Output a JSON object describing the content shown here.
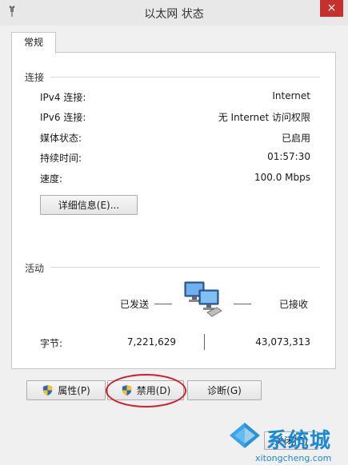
{
  "window": {
    "title": "以太网 状态",
    "close_symbol": "×",
    "system_icon": "network-plug-icon"
  },
  "tabs": [
    {
      "label": "常规"
    }
  ],
  "connection": {
    "section_title": "连接",
    "rows": [
      {
        "label": "IPv4 连接:",
        "value": "Internet"
      },
      {
        "label": "IPv6 连接:",
        "value": "无 Internet 访问权限"
      },
      {
        "label": "媒体状态:",
        "value": "已启用"
      },
      {
        "label": "持续时间:",
        "value": "01:57:30"
      },
      {
        "label": "速度:",
        "value": "100.0 Mbps"
      }
    ],
    "details_button": "详细信息(E)..."
  },
  "activity": {
    "section_title": "活动",
    "sent_label": "已发送",
    "received_label": "已接收",
    "bytes_label": "字节:",
    "bytes_sent": "7,221,629",
    "bytes_received": "43,073,313",
    "icon": "network-computers-icon"
  },
  "buttons": {
    "properties": "属性(P)",
    "disable": "禁用(D)",
    "diagnose": "诊断(G)",
    "close": "关闭(C)"
  },
  "watermark": {
    "brand": "系统城",
    "domain": "xitongcheng.com"
  },
  "colors": {
    "highlight_oval": "#d21e2b",
    "close_button": "#c7312d",
    "watermark_blue": "#1a8ad4"
  }
}
